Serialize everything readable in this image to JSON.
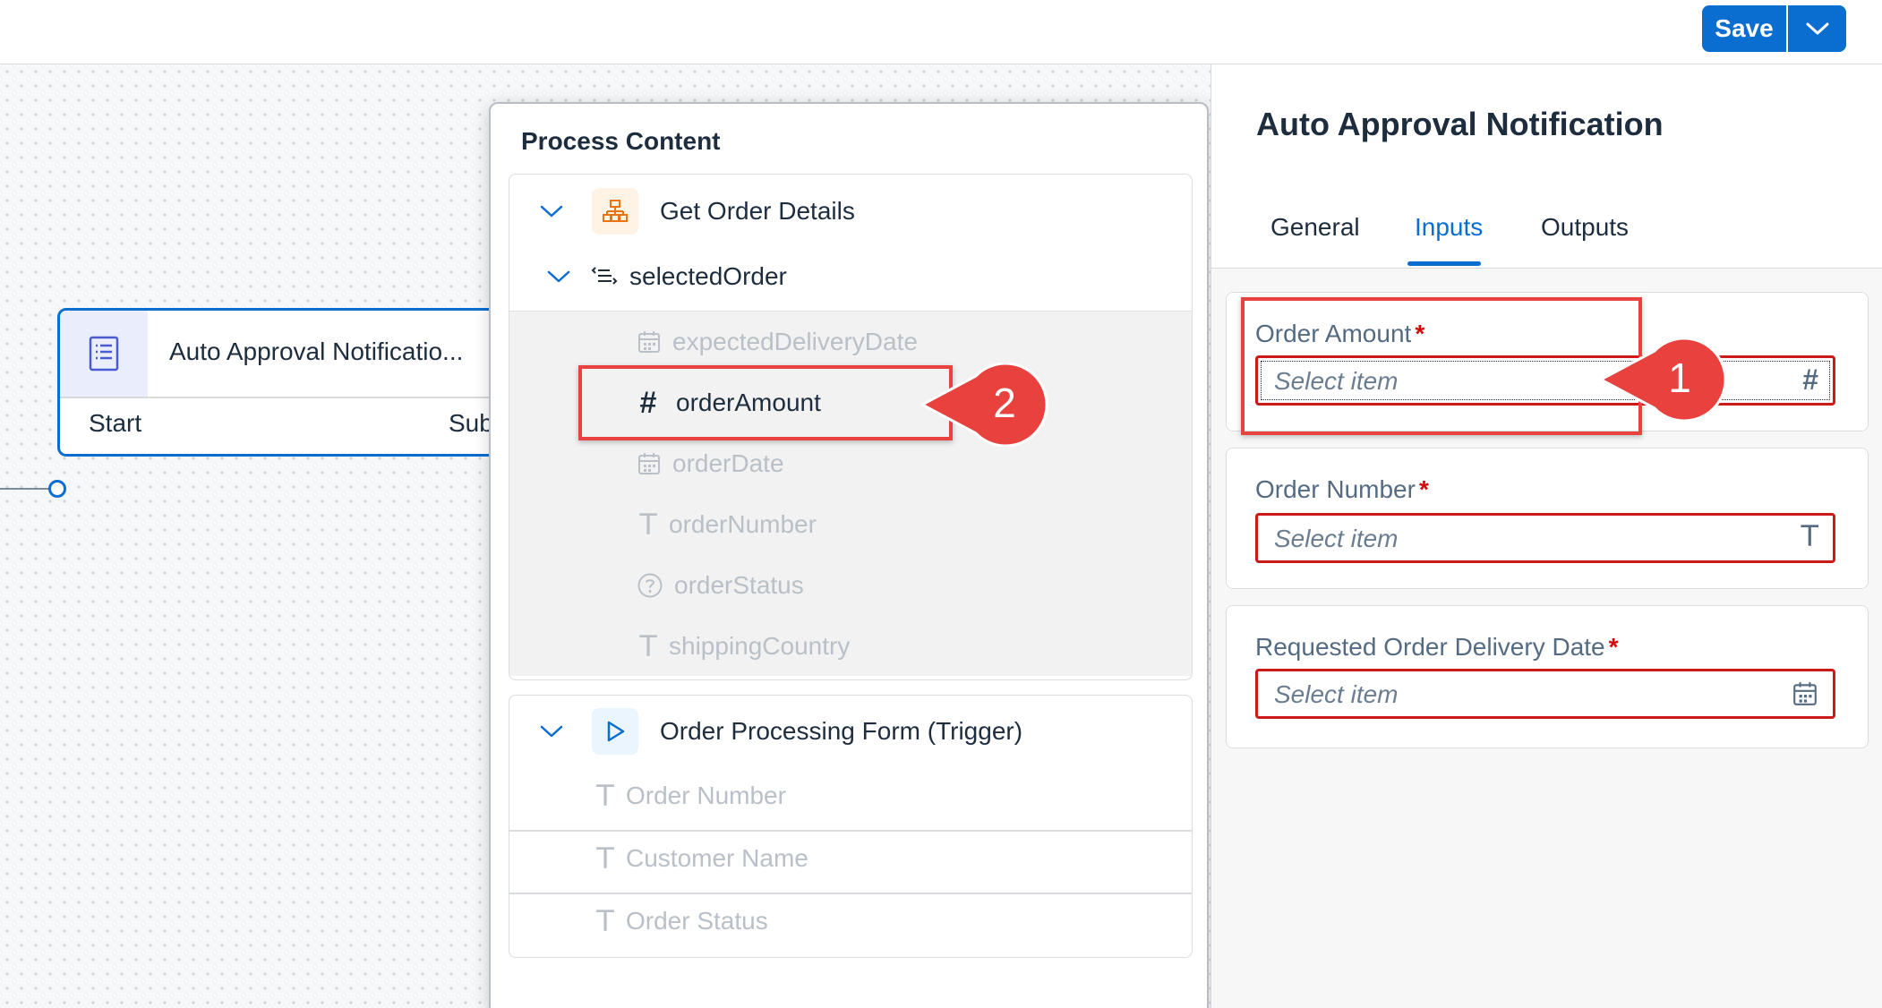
{
  "toolbar": {
    "save_label": "Save",
    "save_menu_icon": "chevron-down-icon",
    "accent_color": "#0a6ed1"
  },
  "canvas": {
    "node": {
      "title": "Auto Approval Notificatio...",
      "icon": "form-icon",
      "start_label": "Start",
      "sub_label": "Sub"
    }
  },
  "process_content": {
    "title": "Process Content",
    "groups": [
      {
        "title": "Get Order Details",
        "icon": "hierarchy-icon",
        "expanded": true,
        "children": [
          {
            "title": "selectedOrder",
            "icon": "structure-icon",
            "expanded": true,
            "fields": [
              {
                "name": "expectedDeliveryDate",
                "type_icon": "calendar-icon",
                "enabled": false
              },
              {
                "name": "orderAmount",
                "type_icon": "number-icon",
                "enabled": true
              },
              {
                "name": "orderDate",
                "type_icon": "calendar-icon",
                "enabled": false
              },
              {
                "name": "orderNumber",
                "type_icon": "text-icon",
                "enabled": false
              },
              {
                "name": "orderStatus",
                "type_icon": "question-icon",
                "enabled": false
              },
              {
                "name": "shippingCountry",
                "type_icon": "text-icon",
                "enabled": false
              }
            ]
          }
        ]
      },
      {
        "title": "Order Processing Form (Trigger)",
        "icon": "play-icon",
        "expanded": true,
        "fields": [
          {
            "name": "Order Number",
            "type_icon": "text-icon",
            "enabled": false
          },
          {
            "name": "Customer Name",
            "type_icon": "text-icon",
            "enabled": false
          },
          {
            "name": "Order Status",
            "type_icon": "text-icon",
            "enabled": false
          }
        ]
      }
    ]
  },
  "properties": {
    "title": "Auto Approval Notification",
    "tabs": [
      {
        "label": "General",
        "active": false
      },
      {
        "label": "Inputs",
        "active": true
      },
      {
        "label": "Outputs",
        "active": false
      }
    ],
    "required_marker": "*",
    "fields": [
      {
        "label": "Order Amount",
        "placeholder": "Select item",
        "type_icon": "number-icon"
      },
      {
        "label": "Order Number",
        "placeholder": "Select item",
        "type_icon": "text-icon"
      },
      {
        "label": "Requested Order Delivery Date",
        "placeholder": "Select item",
        "type_icon": "calendar-icon"
      }
    ]
  },
  "annotations": {
    "callout_1": "1",
    "callout_2": "2",
    "highlight_color": "#e8413e"
  }
}
